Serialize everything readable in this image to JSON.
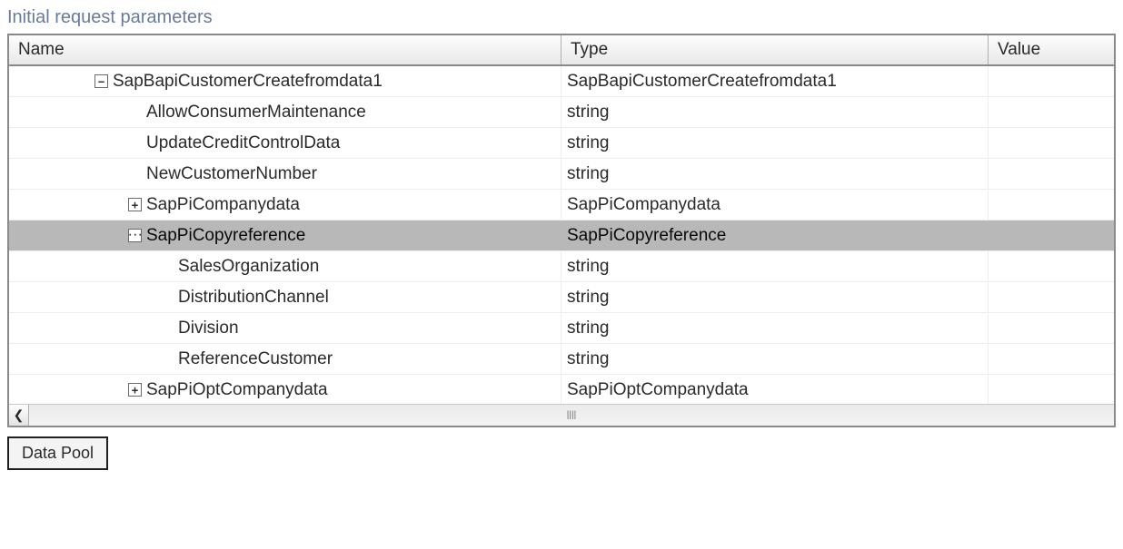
{
  "section_title": "Initial request parameters",
  "columns": {
    "name": "Name",
    "type": "Type",
    "value": "Value"
  },
  "rows": [
    {
      "name": "SapBapiCustomerCreatefromdata1",
      "type": "SapBapiCustomerCreatefromdata1",
      "value": "",
      "indent": 88,
      "expander": "minus",
      "selected": false
    },
    {
      "name": "AllowConsumerMaintenance",
      "type": "string",
      "value": "",
      "indent": 145,
      "expander": "none",
      "selected": false
    },
    {
      "name": "UpdateCreditControlData",
      "type": "string",
      "value": "",
      "indent": 145,
      "expander": "none",
      "selected": false
    },
    {
      "name": "NewCustomerNumber",
      "type": "string",
      "value": "",
      "indent": 145,
      "expander": "none",
      "selected": false
    },
    {
      "name": "SapPiCompanydata",
      "type": "SapPiCompanydata",
      "value": "",
      "indent": 125,
      "expander": "plus",
      "selected": false
    },
    {
      "name": "SapPiCopyreference",
      "type": "SapPiCopyreference",
      "value": "",
      "indent": 125,
      "expander": "dots",
      "selected": true
    },
    {
      "name": "SalesOrganization",
      "type": "string",
      "value": "",
      "indent": 180,
      "expander": "none",
      "selected": false
    },
    {
      "name": "DistributionChannel",
      "type": "string",
      "value": "",
      "indent": 180,
      "expander": "none",
      "selected": false
    },
    {
      "name": "Division",
      "type": "string",
      "value": "",
      "indent": 180,
      "expander": "none",
      "selected": false
    },
    {
      "name": "ReferenceCustomer",
      "type": "string",
      "value": "",
      "indent": 180,
      "expander": "none",
      "selected": false
    },
    {
      "name": "SapPiOptCompanydata",
      "type": "SapPiOptCompanydata",
      "value": "",
      "indent": 125,
      "expander": "plus",
      "selected": false
    }
  ],
  "buttons": {
    "data_pool": "Data Pool"
  },
  "scroll": {
    "left_glyph": "❮",
    "track_glyph": "||||"
  }
}
